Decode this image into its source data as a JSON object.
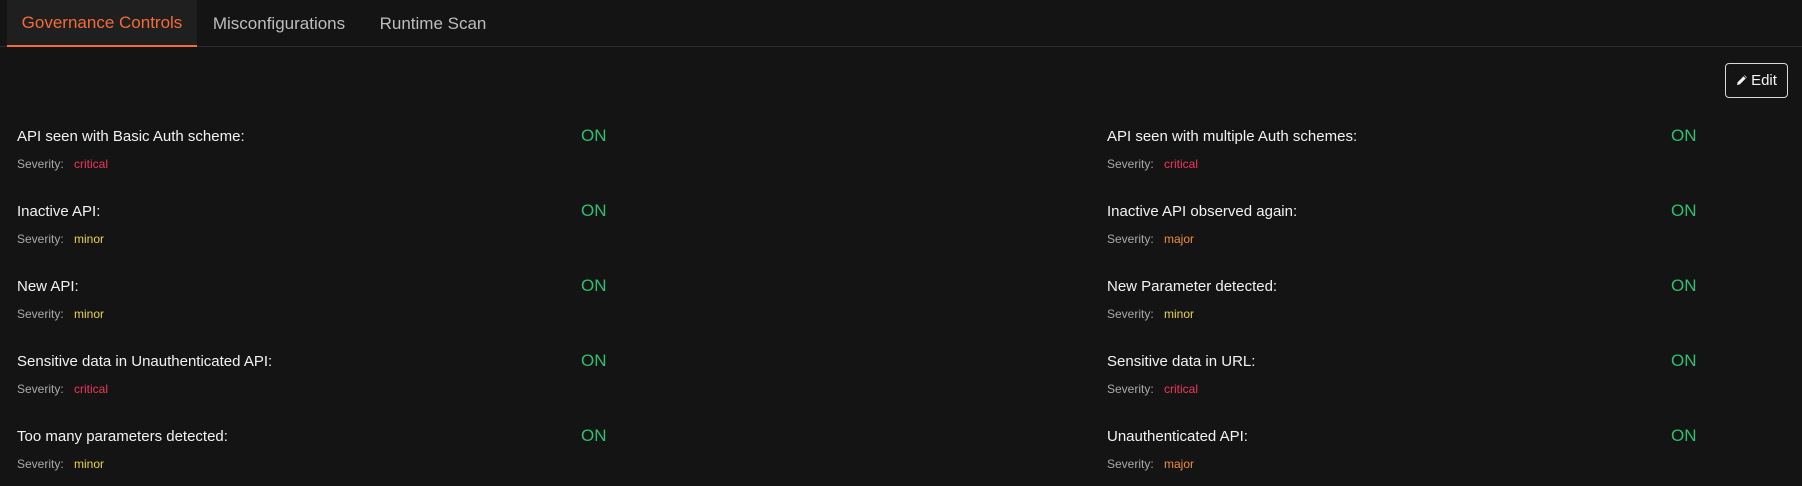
{
  "tabs": [
    {
      "label": "Governance Controls",
      "active": true
    },
    {
      "label": "Misconfigurations",
      "active": false
    },
    {
      "label": "Runtime Scan",
      "active": false
    }
  ],
  "toolbar": {
    "edit_label": "Edit",
    "edit_icon": "pencil-icon"
  },
  "severity_label": "Severity:",
  "colors": {
    "accent": "#f26b38",
    "status_on": "#2fbf71",
    "critical": "#f0365a",
    "major": "#ef8c3a",
    "minor": "#e8d34a",
    "background": "#141414"
  },
  "controls": [
    {
      "title": "API seen with Basic Auth scheme:",
      "status": "ON",
      "severity": "critical"
    },
    {
      "title": "API seen with multiple Auth schemes:",
      "status": "ON",
      "severity": "critical"
    },
    {
      "title": "Inactive API:",
      "status": "ON",
      "severity": "minor"
    },
    {
      "title": "Inactive API observed again:",
      "status": "ON",
      "severity": "major"
    },
    {
      "title": "New API:",
      "status": "ON",
      "severity": "minor"
    },
    {
      "title": "New Parameter detected:",
      "status": "ON",
      "severity": "minor"
    },
    {
      "title": "Sensitive data in Unauthenticated API:",
      "status": "ON",
      "severity": "critical"
    },
    {
      "title": "Sensitive data in URL:",
      "status": "ON",
      "severity": "critical"
    },
    {
      "title": "Too many parameters detected:",
      "status": "ON",
      "severity": "minor"
    },
    {
      "title": "Unauthenticated API:",
      "status": "ON",
      "severity": "major"
    }
  ]
}
